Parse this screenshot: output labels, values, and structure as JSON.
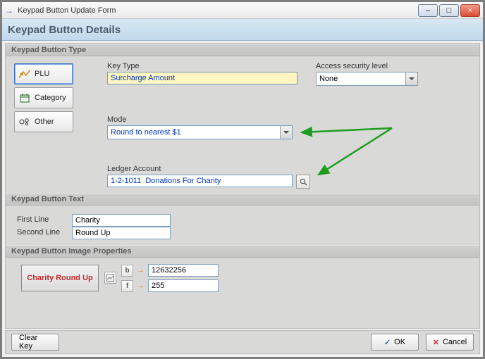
{
  "window": {
    "title": "Keypad Button Update Form",
    "minimize": "–",
    "maximize": "□",
    "close": "×"
  },
  "header": {
    "title": "Keypad Button Details"
  },
  "groups": {
    "type": "Keypad Button Type",
    "text": "Keypad Button Text",
    "image": "Keypad Button Image Properties"
  },
  "typeButtons": {
    "plu": "PLU",
    "category": "Category",
    "other": "Other"
  },
  "fields": {
    "keyType": {
      "label": "Key Type",
      "value": "Surcharge Amount"
    },
    "access": {
      "label": "Access security level",
      "value": "None"
    },
    "mode": {
      "label": "Mode",
      "value": "Round to nearest $1"
    },
    "ledger": {
      "label": "Ledger Account",
      "value": "1-2-1011  Donations For Charity"
    },
    "firstLine": {
      "label": "First Line",
      "value": "Charity"
    },
    "secondLine": {
      "label": "Second Line",
      "value": "Round Up"
    }
  },
  "image": {
    "preview": "Charity Round Up",
    "bLabel": "b",
    "fLabel": "f",
    "bValue": "12632256",
    "fValue": "255",
    "arrow": "→"
  },
  "buttons": {
    "clear": "Clear Key",
    "ok": "OK",
    "cancel": "Cancel"
  }
}
